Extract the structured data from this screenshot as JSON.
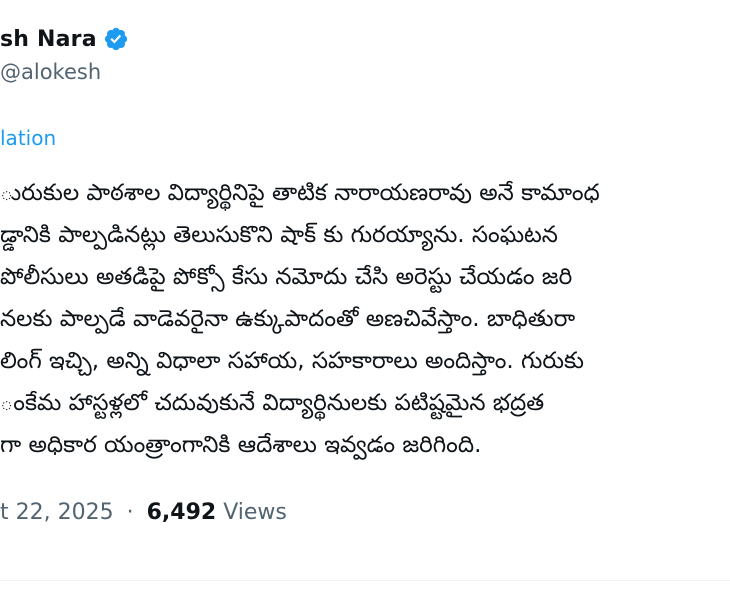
{
  "author": {
    "name": "sh Nara",
    "handle": "alokesh",
    "verified": true,
    "verified_color": "#1d9bf0"
  },
  "translate_link": "lation",
  "tweet": {
    "lines": [
      "ురుకుల పాఠశాల విద్యార్థినిపై తాటిక నారాయణరావు అనే కామాంధ",
      "డ్డానికి పాల్పడినట్లు తెలుసుకొని షాక్ కు గురయ్యాను. సంఘటన",
      "పోలీసులు అతడిపై పోక్సో కేసు నమోదు చేసి అరెస్టు చేయడం జరి",
      "నలకు పాల్పడే వాడెవరైనా ఉక్కుపాదంతో అణచివేస్తాం. బాధితురా",
      "లింగ్ ఇచ్చి, అన్ని విధాలా సహాయ, సహకారాలు అందిస్తాం. గురుకు",
      "ంకేమ హాస్టళ్లలో చదువుకునే విద్యార్థినులకు పటిష్టమైన భద్రత",
      "గా అధికార యంత్రాంగానికి ఆదేశాలు ఇవ్వడం జరిగింది."
    ]
  },
  "meta": {
    "date": "t 22, 2025",
    "separator": "·",
    "views_count": "6,492",
    "views_label": "Views"
  }
}
